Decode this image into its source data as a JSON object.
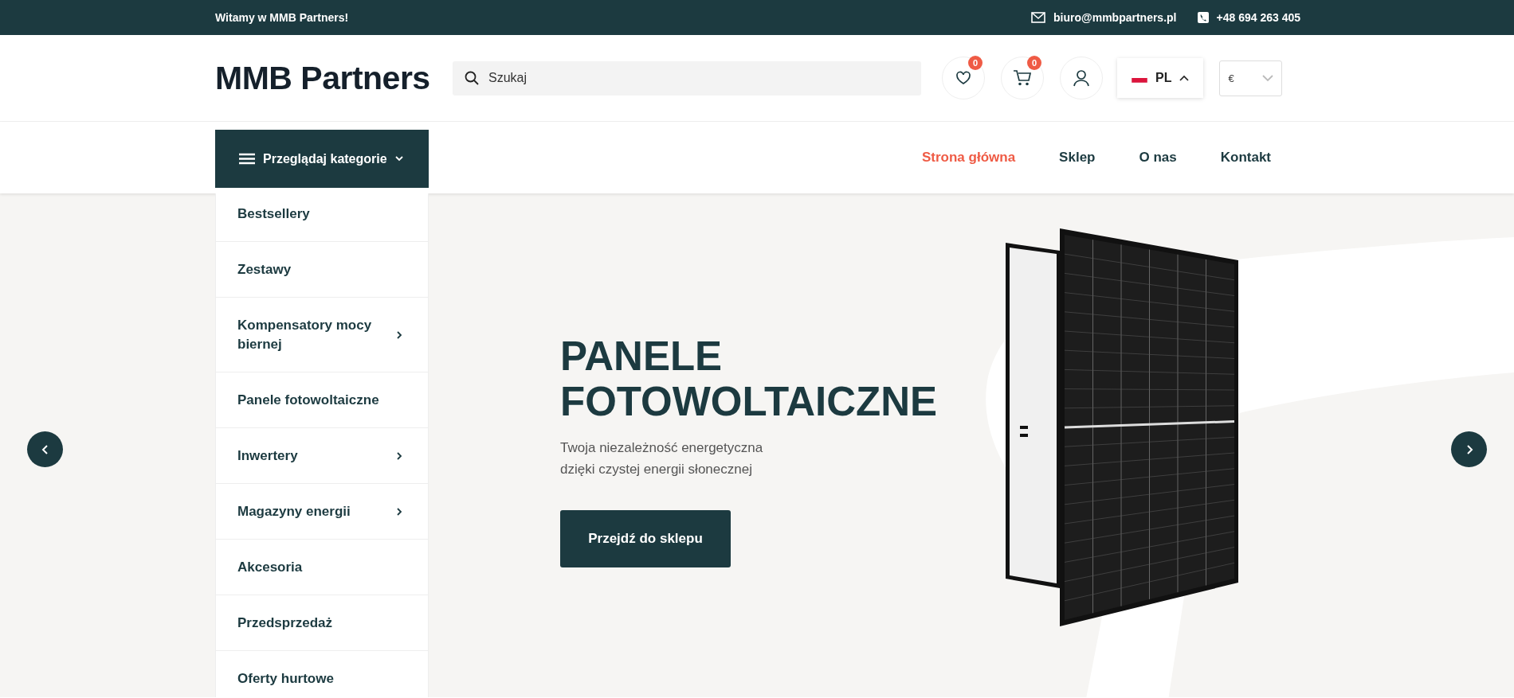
{
  "top_bar": {
    "greeting": "Witamy w MMB Partners!",
    "email": "biuro@mmbpartners.pl",
    "phone": "+48 694 263 405"
  },
  "header": {
    "logo": "MMB Partners",
    "search": {
      "placeholder": "Szukaj"
    },
    "wishlist_count": "0",
    "cart_count": "0",
    "language": "PL",
    "currency": "€"
  },
  "nav": {
    "category_button": "Przeglądaj kategorie",
    "links": [
      {
        "label": "Strona główna",
        "selected": true
      },
      {
        "label": "Sklep",
        "selected": false
      },
      {
        "label": "O nas",
        "selected": false
      },
      {
        "label": "Kontakt",
        "selected": false
      }
    ]
  },
  "categories": [
    {
      "label": "Bestsellery",
      "has_submenu": false
    },
    {
      "label": "Zestawy",
      "has_submenu": false
    },
    {
      "label": "Kompensatory mocy biernej",
      "has_submenu": true
    },
    {
      "label": "Panele fotowoltaiczne",
      "has_submenu": false
    },
    {
      "label": "Inwertery",
      "has_submenu": true
    },
    {
      "label": "Magazyny energii",
      "has_submenu": true
    },
    {
      "label": "Akcesoria",
      "has_submenu": false
    },
    {
      "label": "Przedsprzedaż",
      "has_submenu": false
    },
    {
      "label": "Oferty hurtowe",
      "has_submenu": false
    }
  ],
  "hero": {
    "title_lines": [
      "PANELE",
      "FOTOWOLTAICZNE"
    ],
    "subtitle_lines": [
      "Twoja niezależność energetyczna",
      "dzięki czystej energii słonecznej"
    ],
    "button": "Przejdź do sklepu"
  }
}
